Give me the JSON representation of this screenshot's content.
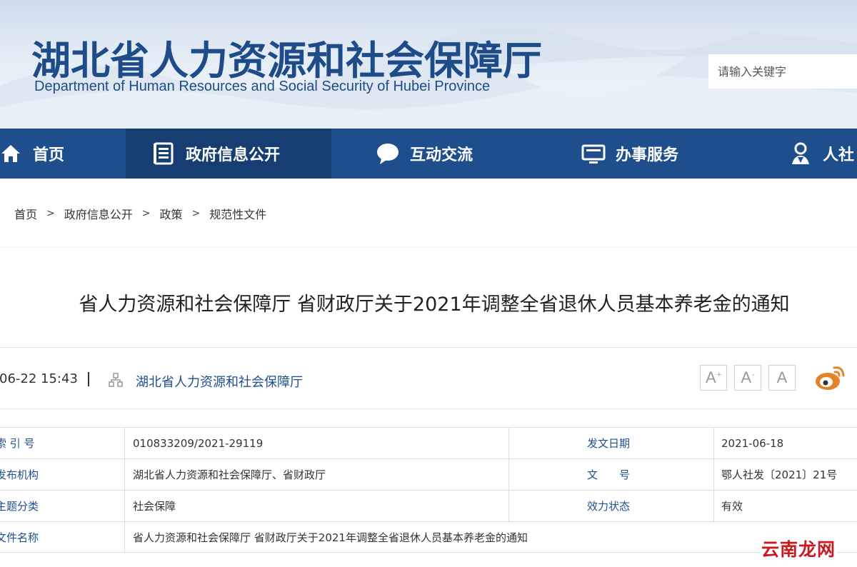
{
  "header": {
    "site_title": "湖北省人力资源和社会保障厅",
    "site_subtitle": "Department of Human Resources and Social Security of Hubei Province",
    "search_placeholder": "请输入关键字"
  },
  "nav": {
    "items": [
      {
        "label": "首页",
        "icon": "home-icon"
      },
      {
        "label": "政府信息公开",
        "icon": "document-list-icon",
        "active": true
      },
      {
        "label": "互动交流",
        "icon": "chat-bubble-icon"
      },
      {
        "label": "办事服务",
        "icon": "monitor-icon"
      },
      {
        "label": "人社",
        "icon": "person-badge-icon"
      }
    ]
  },
  "breadcrumb": {
    "items": [
      "首页",
      "政府信息公开",
      "政策",
      "规范性文件"
    ],
    "separator": ">"
  },
  "article": {
    "title": "省人力资源和社会保障厅 省财政厅关于2021年调整全省退休人员基本养老金的通知",
    "date": "06-22 15:43",
    "source": "湖北省人力资源和社会保障厅"
  },
  "font_controls": {
    "larger": "A",
    "larger_mark": "+",
    "smaller": "A",
    "smaller_mark": "-",
    "default": "A"
  },
  "share": {
    "icon": "weibo-icon"
  },
  "info_table": {
    "rows": [
      {
        "label1": "索 引 号",
        "value1": "010833209/2021-29119",
        "label2": "发文日期",
        "value2": "2021-06-18"
      },
      {
        "label1": "发布机构",
        "value1": "湖北省人力资源和社会保障厅、省财政厅",
        "label2": "文　　号",
        "value2": "鄂人社发〔2021〕21号"
      },
      {
        "label1": "主题分类",
        "value1": "社会保障",
        "label2": "效力状态",
        "value2": "有效"
      },
      {
        "label1": "文件名称",
        "value1": "省人力资源和社会保障厅 省财政厅关于2021年调整全省退休人员基本养老金的通知"
      }
    ]
  },
  "watermark": {
    "text": "云南龙网"
  },
  "colors": {
    "brand_blue": "#1e4f8c",
    "nav_active": "#163e72",
    "watermark_red": "#c8191e",
    "weibo_orange": "#e6822a"
  }
}
